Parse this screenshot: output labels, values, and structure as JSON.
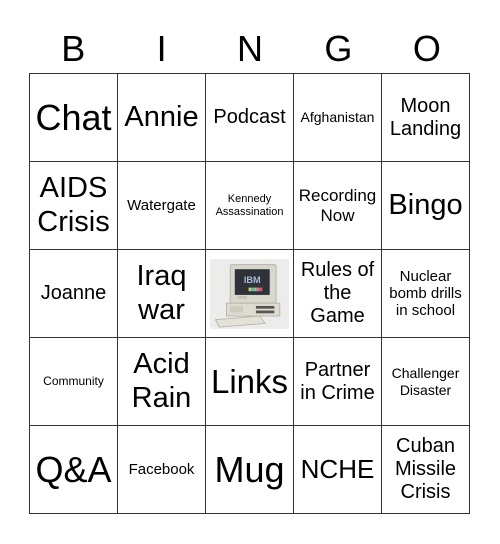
{
  "header": {
    "letters": [
      "B",
      "I",
      "N",
      "G",
      "O"
    ]
  },
  "cells": [
    "Chat",
    "Annie",
    "Podcast",
    "Afghanistan",
    "Moon Landing",
    "AIDS Crisis",
    "Watergate",
    "Kennedy Assassination",
    "Recording Now",
    "Bingo",
    "Joanne",
    "Iraq war",
    "",
    "Rules of the Game",
    "Nuclear bomb drills in school",
    "Community",
    "Acid Rain",
    "Links",
    "Partner in Crime",
    "Challenger Disaster",
    "Q&A",
    "Facebook",
    "Mug",
    "NCHE",
    "Cuban Missile Crisis"
  ],
  "free_space": {
    "image": "vintage-ibm-computer",
    "screen_text": "IBM"
  }
}
